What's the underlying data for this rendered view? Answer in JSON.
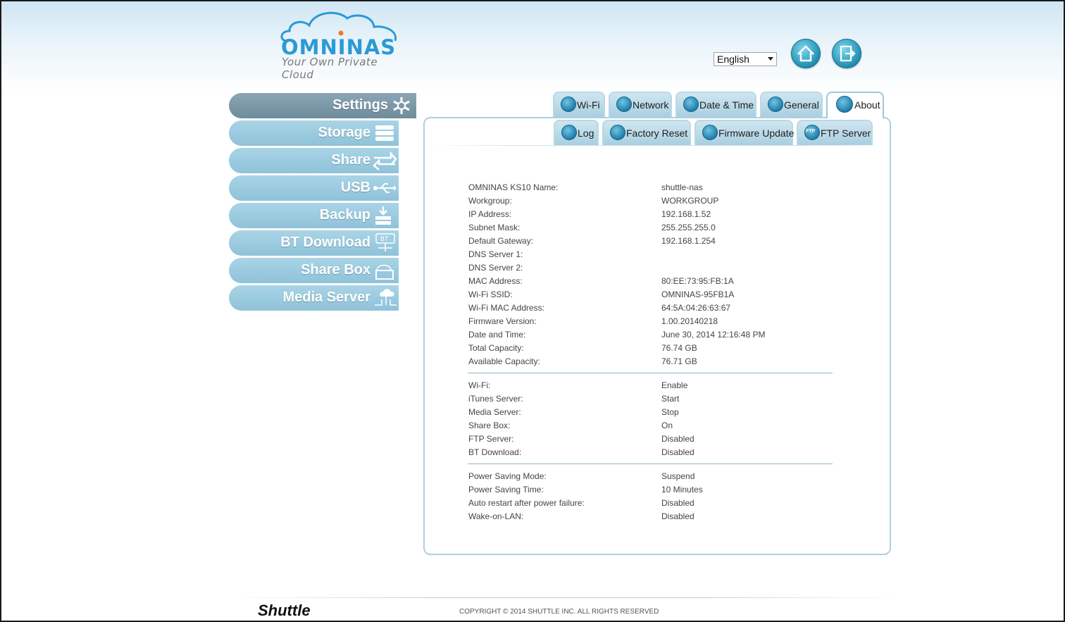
{
  "logo": {
    "brand": "OMNINAS",
    "tagline": "Your Own Private Cloud"
  },
  "language": {
    "selected": "English"
  },
  "top_icons": {
    "home": "home-icon",
    "logout": "logout-icon"
  },
  "sidebar": {
    "items": [
      {
        "label": "Settings",
        "icon": "gear-icon",
        "active": true
      },
      {
        "label": "Storage",
        "icon": "storage-icon",
        "active": false
      },
      {
        "label": "Share",
        "icon": "share-arrows-icon",
        "active": false
      },
      {
        "label": "USB",
        "icon": "usb-icon",
        "active": false
      },
      {
        "label": "Backup",
        "icon": "backup-download-icon",
        "active": false
      },
      {
        "label": "BT Download",
        "icon": "bt-icon",
        "active": false
      },
      {
        "label": "Share Box",
        "icon": "share-box-icon",
        "active": false
      },
      {
        "label": "Media Server",
        "icon": "media-cloud-icon",
        "active": false
      }
    ]
  },
  "tabs": {
    "row1": [
      {
        "label": "Wi-Fi",
        "icon": "wifi-icon"
      },
      {
        "label": "Network",
        "icon": "network-icon"
      },
      {
        "label": "Date & Time",
        "icon": "clock-icon"
      },
      {
        "label": "General",
        "icon": "gears-icon"
      },
      {
        "label": "About",
        "icon": "info-icon",
        "active": true
      }
    ],
    "row2": [
      {
        "label": "Log",
        "icon": "log-icon"
      },
      {
        "label": "Factory Reset",
        "icon": "reset-icon"
      },
      {
        "label": "Firmware Update",
        "icon": "firmware-icon"
      },
      {
        "label": "FTP Server",
        "icon": "ftp-icon",
        "badge": "FTP"
      }
    ]
  },
  "about": {
    "section1": [
      {
        "key": "OMNINAS KS10 Name:",
        "value": "shuttle-nas"
      },
      {
        "key": "Workgroup:",
        "value": "WORKGROUP"
      },
      {
        "key": "IP Address:",
        "value": "192.168.1.52"
      },
      {
        "key": "Subnet Mask:",
        "value": "255.255.255.0"
      },
      {
        "key": "Default Gateway:",
        "value": "192.168.1.254"
      },
      {
        "key": "DNS Server 1:",
        "value": ""
      },
      {
        "key": "DNS Server 2:",
        "value": ""
      },
      {
        "key": "MAC Address:",
        "value": "80:EE:73:95:FB:1A"
      },
      {
        "key": "Wi-Fi SSID:",
        "value": "OMNINAS-95FB1A"
      },
      {
        "key": "Wi-Fi MAC Address:",
        "value": "64:5A:04:26:63:67"
      },
      {
        "key": "Firmware Version:",
        "value": "1.00.20140218"
      },
      {
        "key": "Date and Time:",
        "value": "June 30, 2014 12:16:48 PM"
      },
      {
        "key": "Total Capacity:",
        "value": "76.74 GB"
      },
      {
        "key": "Available Capacity:",
        "value": "76.71 GB"
      }
    ],
    "section2": [
      {
        "key": "Wi-Fi:",
        "value": "Enable"
      },
      {
        "key": "iTunes Server:",
        "value": "Start"
      },
      {
        "key": "Media Server:",
        "value": "Stop"
      },
      {
        "key": "Share Box:",
        "value": "On"
      },
      {
        "key": "FTP Server:",
        "value": "Disabled"
      },
      {
        "key": "BT Download:",
        "value": "Disabled"
      }
    ],
    "section3": [
      {
        "key": "Power Saving Mode:",
        "value": "Suspend"
      },
      {
        "key": "Power Saving Time:",
        "value": "10 Minutes"
      },
      {
        "key": "Auto restart after power failure:",
        "value": "Disabled"
      },
      {
        "key": "Wake-on-LAN:",
        "value": "Disabled"
      }
    ]
  },
  "footer": {
    "brand": "Shuttle",
    "copyright": "COPYRIGHT © 2014 SHUTTLE INC. ALL RIGHTS RESERVED"
  },
  "colors": {
    "accent": "#2b9ad6",
    "sidebar": "#9fcde1",
    "sidebar_active": "#7d98a7"
  }
}
